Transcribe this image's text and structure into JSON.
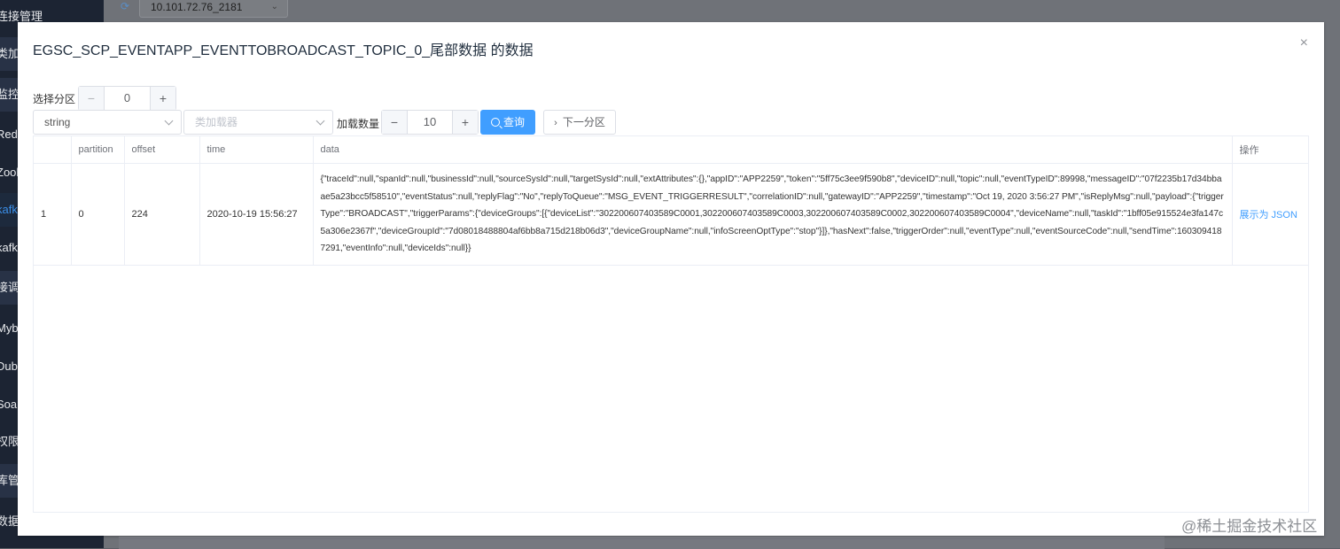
{
  "sidebar": {
    "items": [
      {
        "label": "连接管理"
      },
      {
        "label": "类加载"
      },
      {
        "label": "监控"
      },
      {
        "label": "Redis"
      },
      {
        "label": "Zookeeper"
      },
      {
        "label": "kafka"
      },
      {
        "label": "kafka"
      },
      {
        "label": "接调用"
      },
      {
        "label": "Mybatis"
      },
      {
        "label": "Dubbo"
      },
      {
        "label": "Soap"
      },
      {
        "label": "权限"
      },
      {
        "label": "库管理"
      },
      {
        "label": "数据"
      }
    ]
  },
  "background": {
    "connection_select": "10.101.72.76_2181"
  },
  "dialog": {
    "title": "EGSC_SCP_EVENTAPP_EVENTTOBROADCAST_TOPIC_0_尾部数据 的数据",
    "close_symbol": "×",
    "partition_label": "选择分区",
    "partition_value": "0",
    "serializer_value": "string",
    "class_loader_placeholder": "类加载器",
    "load_count_label": "加载数量",
    "load_count_value": "10",
    "query_button": "查询",
    "next_partition_button": "下一分区",
    "minus": "−",
    "plus": "+"
  },
  "table": {
    "headers": [
      "",
      "partition",
      "offset",
      "time",
      "data",
      "操作"
    ],
    "rows": [
      {
        "index": "1",
        "partition": "0",
        "offset": "224",
        "time": "2020-10-19 15:56:27",
        "data": "{\"traceId\":null,\"spanId\":null,\"businessId\":null,\"sourceSysId\":null,\"targetSysId\":null,\"extAttributes\":{},\"appID\":\"APP2259\",\"token\":\"5ff75c3ee9f590b8\",\"deviceID\":null,\"topic\":null,\"eventTypeID\":89998,\"messageID\":\"07f2235b17d34bbaae5a23bcc5f58510\",\"eventStatus\":null,\"replyFlag\":\"No\",\"replyToQueue\":\"MSG_EVENT_TRIGGERRESULT\",\"correlationID\":null,\"gatewayID\":\"APP2259\",\"timestamp\":\"Oct 19, 2020 3:56:27 PM\",\"isReplyMsg\":null,\"payload\":{\"triggerType\":\"BROADCAST\",\"triggerParams\":{\"deviceGroups\":[{\"deviceList\":\"302200607403589C0001,302200607403589C0003,302200607403589C0002,302200607403589C0004\",\"deviceName\":null,\"taskId\":\"1bff05e915524e3fa147c5a306e2367f\",\"deviceGroupId\":\"7d08018488804af6bb8a715d218b06d3\",\"deviceGroupName\":null,\"infoScreenOptType\":\"stop\"}]},\"hasNext\":false,\"triggerOrder\":null,\"eventType\":null,\"eventSourceCode\":null,\"sendTime\":1603094187291,\"eventInfo\":null,\"deviceIds\":null}}",
        "action": "展示为 JSON"
      }
    ]
  },
  "watermark": "@稀土掘金技术社区"
}
